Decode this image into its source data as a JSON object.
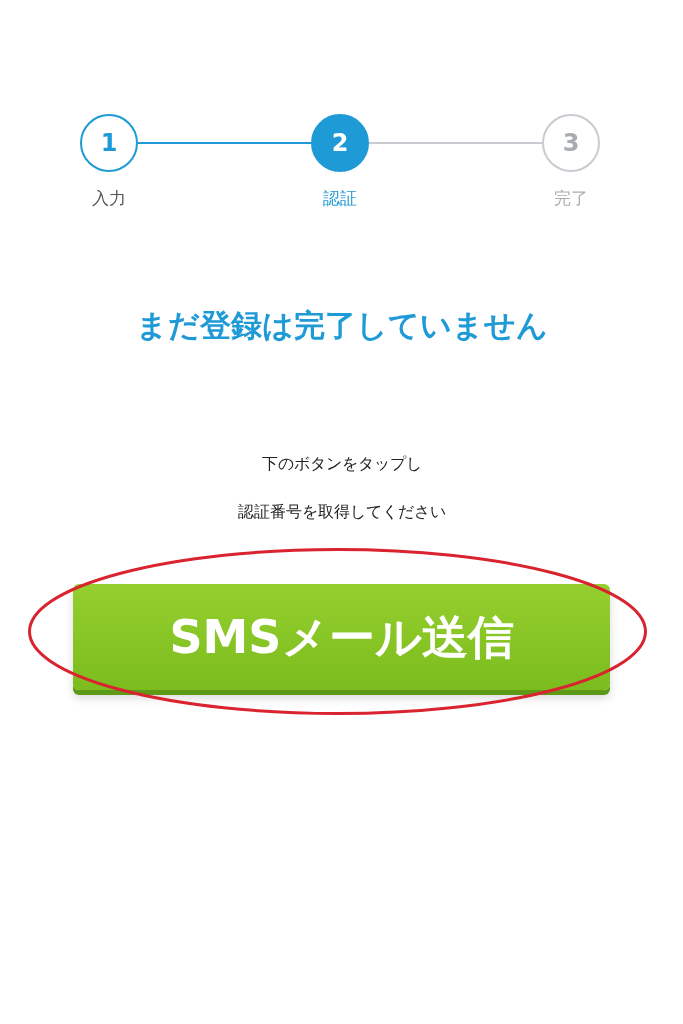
{
  "steps": [
    {
      "number": "1",
      "label": "入力",
      "completed": true,
      "selected": false
    },
    {
      "number": "2",
      "label": "認証",
      "completed": false,
      "selected": true
    },
    {
      "number": "3",
      "label": "完了",
      "completed": false,
      "selected": false
    }
  ],
  "heading": "まだ登録は完了していません",
  "instructions": [
    "下のボタンをタップし",
    "認証番号を取得してください"
  ],
  "button": {
    "label": "SMSメール送信",
    "highlighted": true
  }
}
